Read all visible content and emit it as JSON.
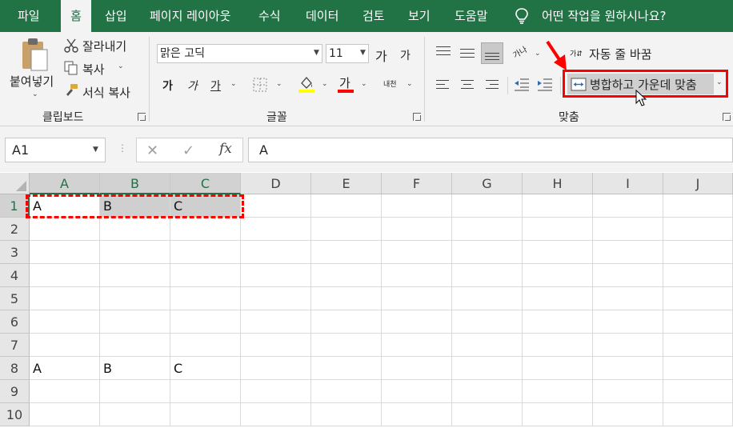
{
  "tabs": [
    {
      "label": "파일",
      "active": false
    },
    {
      "label": "홈",
      "active": true
    },
    {
      "label": "삽입",
      "active": false
    },
    {
      "label": "페이지 레이아웃",
      "active": false
    },
    {
      "label": "수식",
      "active": false
    },
    {
      "label": "데이터",
      "active": false
    },
    {
      "label": "검토",
      "active": false
    },
    {
      "label": "보기",
      "active": false
    },
    {
      "label": "도움말",
      "active": false
    }
  ],
  "tellme": {
    "icon": "lightbulb-icon",
    "text": "어떤 작업을 원하시나요?"
  },
  "clipboard": {
    "paste_label": "붙여넣기",
    "cut_label": "잘라내기",
    "copy_label": "복사",
    "format_painter_label": "서식 복사",
    "group_label": "클립보드"
  },
  "font": {
    "font_name": "맑은 고딕",
    "font_size": "11",
    "grow_glyph": "가",
    "shrink_glyph": "가",
    "bold_glyph": "가",
    "italic_glyph": "가",
    "underline_glyph": "가",
    "font_color_glyph": "가",
    "phonetic_glyph": "내천",
    "group_label": "글꼴"
  },
  "alignment": {
    "orientation_glyph": "가나",
    "wrap_text_label": "자동 줄 바꿈",
    "merge_center_label": "병합하고 가운데 맞춤",
    "group_label": "맞춤"
  },
  "formula_bar": {
    "name_box": "A1",
    "fx_label": "fx",
    "content": "A"
  },
  "columns": [
    "A",
    "B",
    "C",
    "D",
    "E",
    "F",
    "G",
    "H",
    "I",
    "J"
  ],
  "selected_columns": [
    "A",
    "B",
    "C"
  ],
  "rows": [
    {
      "num": "1",
      "cells": [
        "A",
        "B",
        "C"
      ]
    },
    {
      "num": "2",
      "cells": []
    },
    {
      "num": "3",
      "cells": []
    },
    {
      "num": "4",
      "cells": []
    },
    {
      "num": "5",
      "cells": []
    },
    {
      "num": "6",
      "cells": []
    },
    {
      "num": "7",
      "cells": []
    },
    {
      "num": "8",
      "cells": [
        "A",
        "B",
        "C"
      ]
    },
    {
      "num": "9",
      "cells": []
    },
    {
      "num": "10",
      "cells": []
    }
  ],
  "colors": {
    "accent_green": "#217346",
    "highlight_red": "#ff0000",
    "selection_gray": "#d2d2d2"
  }
}
